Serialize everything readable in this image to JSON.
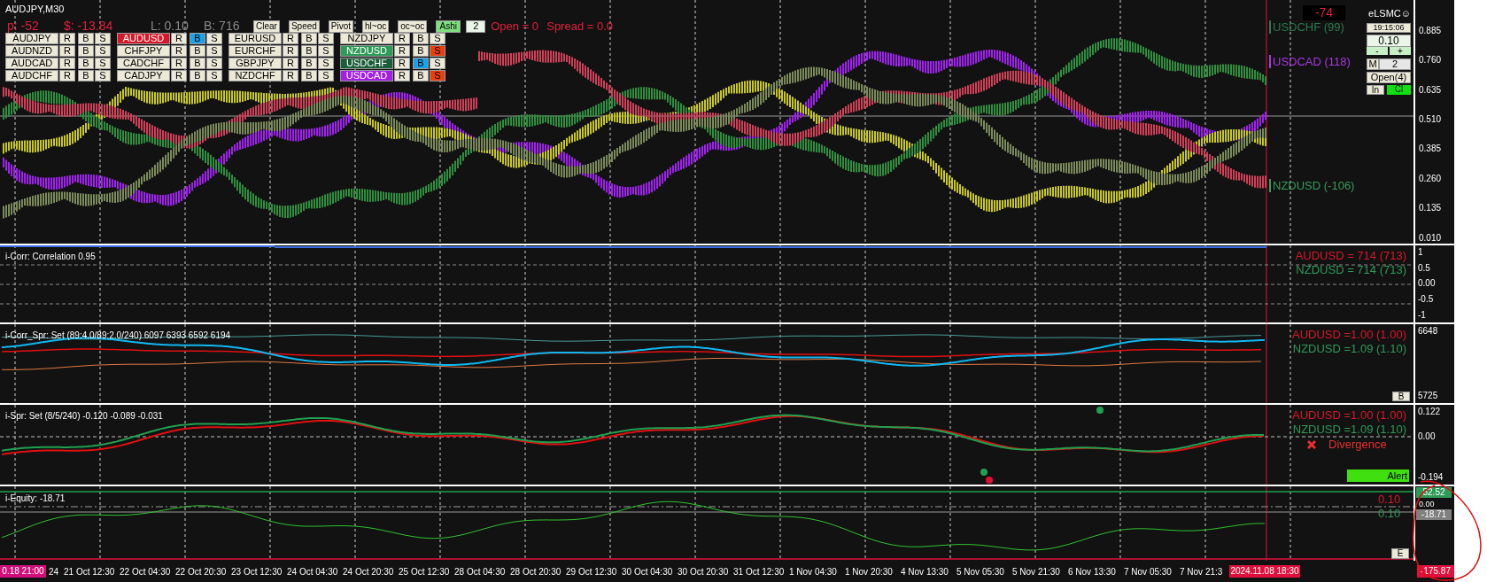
{
  "chart_title": "AUDJPY,M30",
  "status": {
    "profit": "p: -52",
    "money": "$: -13.84",
    "lots": "L: 0.10",
    "bars": "B: 716"
  },
  "toolbar_buttons": [
    {
      "label": "Clear",
      "selected": false
    },
    {
      "label": "Speed",
      "selected": false
    },
    {
      "label": "Pivot",
      "selected": false
    },
    {
      "label": "hl~oc",
      "selected": false
    },
    {
      "label": "oc~oc",
      "selected": false
    },
    {
      "label": "Ashi",
      "selected": true
    }
  ],
  "period_field": {
    "value": "2"
  },
  "open_count": "Open = 0",
  "spread": "Spread = 0.0",
  "symbol_grid": [
    {
      "symbol": "AUDJPY",
      "r": "R",
      "b": "B",
      "s": "S",
      "buy_on": false,
      "sell_on": false
    },
    {
      "symbol": "AUDUSD",
      "color": "#d8182a",
      "r": "R",
      "b": "B",
      "s": "S",
      "buy_on": true,
      "sell_on": false
    },
    {
      "symbol": "EURUSD",
      "r": "R",
      "b": "B",
      "s": "S",
      "buy_on": false,
      "sell_on": false
    },
    {
      "symbol": "NZDJPY",
      "r": "R",
      "b": "B",
      "s": "S",
      "buy_on": false,
      "sell_on": false
    },
    {
      "symbol": "AUDNZD",
      "r": "R",
      "b": "B",
      "s": "S",
      "buy_on": false,
      "sell_on": false
    },
    {
      "symbol": "CHFJPY",
      "r": "R",
      "b": "B",
      "s": "S",
      "buy_on": false,
      "sell_on": false
    },
    {
      "symbol": "EURCHF",
      "r": "R",
      "b": "B",
      "s": "S",
      "buy_on": false,
      "sell_on": false
    },
    {
      "symbol": "NZDUSD",
      "color": "#2e9a58",
      "r": "R",
      "b": "B",
      "s": "S",
      "buy_on": false,
      "sell_on": true
    },
    {
      "symbol": "AUDCAD",
      "r": "R",
      "b": "B",
      "s": "S",
      "buy_on": false,
      "sell_on": false
    },
    {
      "symbol": "CADCHF",
      "r": "R",
      "b": "B",
      "s": "S",
      "buy_on": false,
      "sell_on": false
    },
    {
      "symbol": "GBPJPY",
      "r": "R",
      "b": "B",
      "s": "S",
      "buy_on": false,
      "sell_on": false
    },
    {
      "symbol": "USDCHF",
      "color": "#1d5e3a",
      "r": "R",
      "b": "B",
      "s": "S",
      "buy_on": true,
      "sell_on": false
    },
    {
      "symbol": "AUDCHF",
      "r": "R",
      "b": "B",
      "s": "S",
      "buy_on": false,
      "sell_on": false
    },
    {
      "symbol": "CADJPY",
      "r": "R",
      "b": "B",
      "s": "S",
      "buy_on": false,
      "sell_on": false
    },
    {
      "symbol": "NZDCHF",
      "r": "R",
      "b": "B",
      "s": "S",
      "buy_on": false,
      "sell_on": false
    },
    {
      "symbol": "USDCAD",
      "color": "#a41fe6",
      "r": "R",
      "b": "B",
      "s": "S",
      "buy_on": false,
      "sell_on": true
    }
  ],
  "pips_badge": "-74",
  "series_labels": [
    {
      "text": "USDCHF (99)",
      "color": "#2c7a4c"
    },
    {
      "text": "USDCAD (118)",
      "color": "#a63ae0"
    },
    {
      "text": "NZDUSD (-106)",
      "color": "#3a9a5c"
    }
  ],
  "side_panel": {
    "brand": "eLSMC☺",
    "time": "19:15:06",
    "lot": "0.10",
    "minus": "-",
    "plus": "+",
    "m_label": "M",
    "m_value": "2",
    "open_button": "Open(4)",
    "in_button": "In",
    "close_button": "Cl"
  },
  "main_axis": [
    "0.885",
    "0.760",
    "0.635",
    "0.510",
    "0.385",
    "0.260",
    "0.135",
    "0.010"
  ],
  "correlation_panel": {
    "title": "i-Corr: Correlation 0.95",
    "legends": [
      {
        "text": "AUDUSD = 714 (713)",
        "color": "#d8182a"
      },
      {
        "text": "NZDUSD = 714 (713)",
        "color": "#2e9a58"
      }
    ],
    "axis": [
      "1",
      "0.5",
      "0.00",
      "-0.5",
      "-1"
    ]
  },
  "corr_spread_panel": {
    "title": "i-Corr_Spr: Set (89:4.0/89:2.0/240) 6097 6393 6592 6194",
    "legends": [
      {
        "text": "AUDUSD =1.00 (1.00)",
        "color": "#d8182a"
      },
      {
        "text": "NZDUSD =1.09 (1.10)",
        "color": "#2e9a58"
      }
    ],
    "axis": [
      "6648",
      "5725"
    ],
    "button": "B"
  },
  "spread_panel": {
    "title": "i-Spr: Set (8/5/240) -0.120 -0.089 -0.031",
    "legends": [
      {
        "text": "AUDUSD =1.00 (1.00)",
        "color": "#d8182a"
      },
      {
        "text": "NZDUSD =1.09 (1.10)",
        "color": "#2e9a58"
      }
    ],
    "axis": [
      "0.122",
      "0.00",
      "-0.194"
    ],
    "divergence": "Divergence",
    "alert_button": "Alert"
  },
  "equity_panel": {
    "title": "i-Equity: -18.71",
    "levels": [
      {
        "text": "0.10",
        "color": "#d8182a"
      },
      {
        "text": "0.10",
        "color": "#2e9a58"
      }
    ],
    "axis_label": "0.00",
    "badges": [
      {
        "text": "52.52",
        "color": "#2e9a58"
      },
      {
        "text": "-18.71",
        "color": "#808080"
      }
    ],
    "bottom_badge": "-175.87",
    "button": "E"
  },
  "time_axis": {
    "start_badge": "0.18 21:00",
    "partial": "24",
    "labels": [
      "21 Oct 12:30",
      "22 Oct 04:30",
      "22 Oct 20:30",
      "23 Oct 12:30",
      "24 Oct 04:30",
      "24 Oct 20:30",
      "25 Oct 12:30",
      "28 Oct 04:30",
      "28 Oct 20:30",
      "29 Oct 12:30",
      "30 Oct 04:30",
      "30 Oct 20:30",
      "31 Oct 12:30",
      "1 Nov 04:30",
      "1 Nov 20:30",
      "4 Nov 13:30",
      "5 Nov 05:30",
      "5 Nov 21:30",
      "6 Nov 13:30",
      "7 Nov 05:30",
      "7 Nov 21:3"
    ],
    "cursor_badge": "2024.11.08 18:30"
  }
}
